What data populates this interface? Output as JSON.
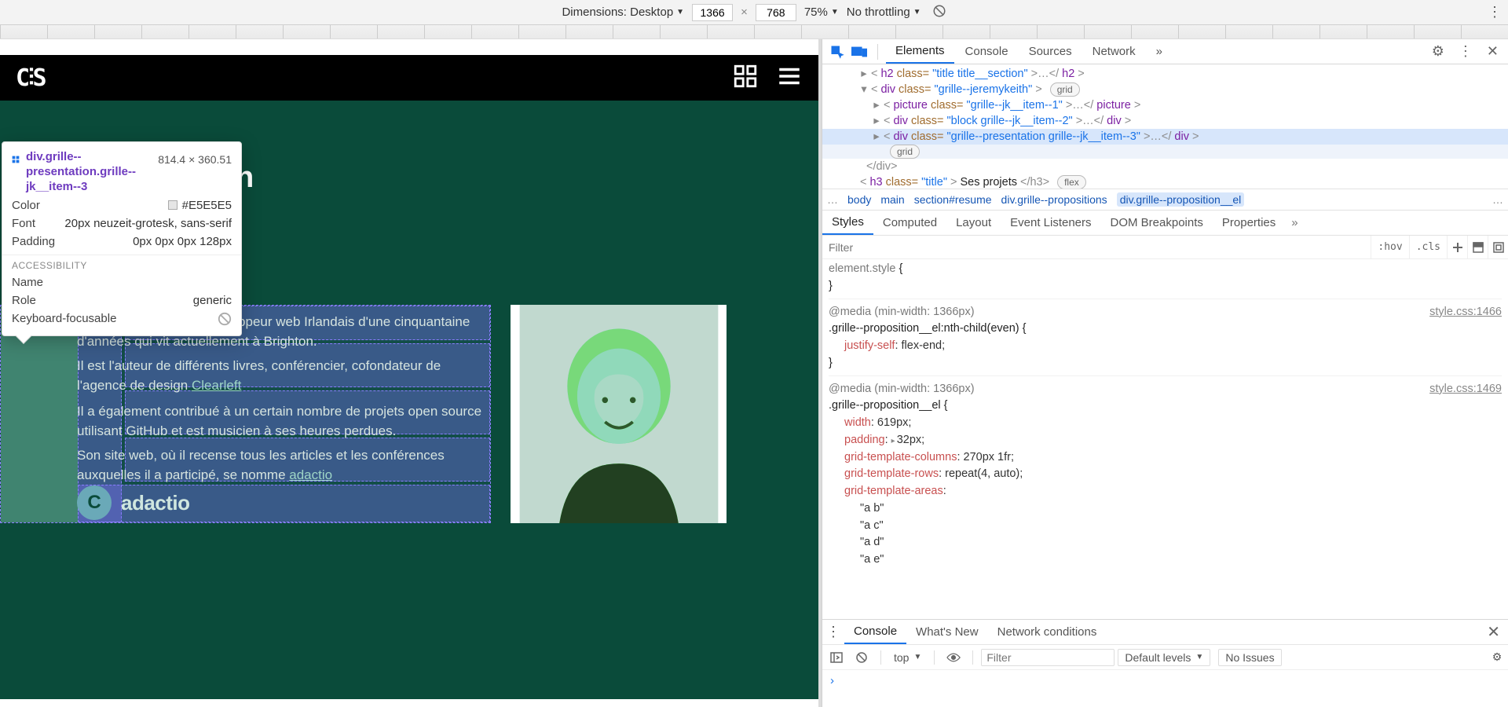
{
  "device_toolbar": {
    "dimensions_label": "Dimensions: Desktop",
    "width": "1366",
    "height": "768",
    "sep": "×",
    "zoom": "75%",
    "throttle": "No throttling"
  },
  "devtools_tabs": {
    "elements": "Elements",
    "console": "Console",
    "sources": "Sources",
    "network": "Network"
  },
  "dom": {
    "l1": {
      "pre": "<",
      "tag": "h2",
      "attr": " class=",
      "val": "\"title title__section\"",
      "post": ">…</",
      "tag2": "h2",
      "end": ">"
    },
    "l2": {
      "pre": "<",
      "tag": "div",
      "attr": " class=",
      "val": "\"grille--jeremykeith\"",
      "post": ">",
      "badge": "grid"
    },
    "l3": {
      "pre": "<",
      "tag": "picture",
      "attr": " class=",
      "val": "\"grille--jk__item--1\"",
      "post": ">…</",
      "tag2": "picture",
      "end": ">"
    },
    "l4": {
      "pre": "<",
      "tag": "div",
      "attr": " class=",
      "val": "\"block grille--jk__item--2\"",
      "post": ">…</",
      "tag2": "div",
      "end": ">"
    },
    "l5": {
      "pre": "<",
      "tag": "div",
      "attr": " class=",
      "val": "\"grille--presentation grille--jk__item--3\"",
      "post": ">…</",
      "tag2": "div",
      "end": ">"
    },
    "l5badge": "grid",
    "l6": {
      "txt": "</div>"
    },
    "l7": {
      "pre": "<",
      "tag": "h3",
      "attr": " class=",
      "val": "\"title\"",
      "post": ">",
      "inner": "Ses projets",
      "end": "</h3>",
      "badge": "flex"
    }
  },
  "breadcrumbs": {
    "dots": "…",
    "items": [
      "body",
      "main",
      "section#resume",
      "div.grille--propositions",
      "div.grille--proposition__el"
    ],
    "more": "…"
  },
  "styles_tabs": {
    "styles": "Styles",
    "computed": "Computed",
    "layout": "Layout",
    "listeners": "Event Listeners",
    "dombp": "DOM Breakpoints",
    "props": "Properties"
  },
  "filter": {
    "placeholder": "Filter",
    "hov": ":hov",
    "cls": ".cls"
  },
  "rules": {
    "r0": {
      "sel": "element.style",
      "open": " {",
      "close": "}"
    },
    "r1": {
      "media": "@media (min-width: 1366px)",
      "selector": ".grille--proposition__el:nth-child(even) {",
      "src": "style.css:1466",
      "prop1_name": "justify-self",
      "prop1_val": ": flex-end;",
      "close": "}"
    },
    "r2": {
      "media": "@media (min-width: 1366px)",
      "selector": ".grille--proposition__el {",
      "src": "style.css:1469",
      "p": [
        {
          "n": "width",
          "v": ": 619px;"
        },
        {
          "n": "padding",
          "v": ": ",
          "chev": "▸",
          "v2": "32px;"
        },
        {
          "n": "grid-template-columns",
          "v": ": 270px 1fr;"
        },
        {
          "n": "grid-template-rows",
          "v": ": repeat(4, auto);"
        },
        {
          "n": "grid-template-areas",
          "v": ":"
        }
      ],
      "areas": [
        "\"a b\"",
        "\"a c\"",
        "\"a d\"",
        "\"a e\""
      ]
    }
  },
  "drawer": {
    "tabs": {
      "console": "Console",
      "whatsnew": "What's New",
      "netcond": "Network conditions"
    },
    "toolbar": {
      "context": "top",
      "filter_placeholder": "Filter",
      "levels": "Default levels",
      "issues": "No Issues"
    },
    "prompt": "›"
  },
  "tooltip": {
    "selector": "div.grille--presentation.grille--jk__item--3",
    "dims": "814.4 × 360.51",
    "rows": {
      "color_k": "Color",
      "color_v": "#E5E5E5",
      "font_k": "Font",
      "font_v": "20px neuzeit-grotesk, sans-serif",
      "pad_k": "Padding",
      "pad_v": "0px 0px 0px 128px"
    },
    "a11y_label": "ACCESSIBILITY",
    "a11y": {
      "name_k": "Name",
      "name_v": "",
      "role_k": "Role",
      "role_v": "generic",
      "kf_k": "Keyboard-focusable"
    }
  },
  "page": {
    "logo": "C⫶S",
    "heading_partial": "h",
    "para1": "Jeremy Keith est un développeur web Irlandais d'une cinquantaine d'années qui vit actuellement à Brighton.",
    "para2a": "Il est l'auteur de différents livres, conférencier, cofondateur de l'agence de design ",
    "para2_link": "Clearleft",
    "para3": "Il a également contribué à un certain nombre de projets open source utilisant GitHub et est musicien à ses heures perdues.",
    "para4a": "Son site web, où il recense tous les articles et les conférences auxquelles il a participé, se nomme ",
    "para4_link": "adactio",
    "adactio_word": "adactio"
  }
}
